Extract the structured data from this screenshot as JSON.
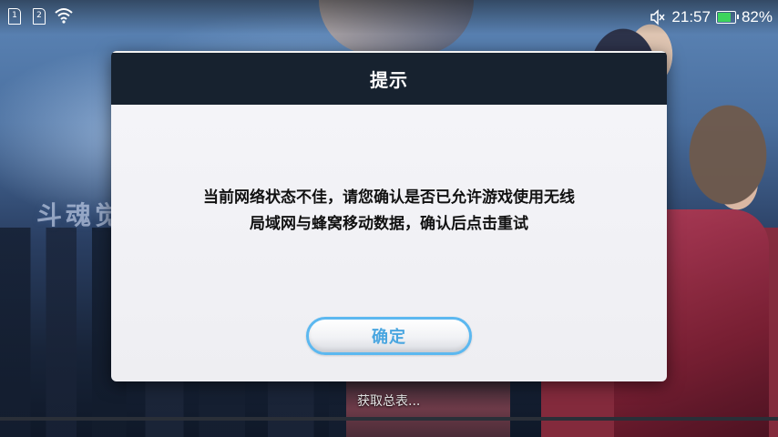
{
  "status_bar": {
    "sim1": "1",
    "sim2": "2",
    "time": "21:57",
    "battery_percent": "82%",
    "battery_level": 0.82,
    "icons": [
      "sim-card-icon",
      "sim-card-icon",
      "wifi-icon",
      "mute-icon",
      "battery-icon"
    ]
  },
  "background": {
    "game_title": "斗魂觉",
    "loading_text": "获取总表..."
  },
  "dialog": {
    "title": "提示",
    "message_lines": [
      "当前网络状态不佳，请您确认是否已允许游戏使用无线",
      "局域网与蜂窝移动数据，确认后点击重试"
    ],
    "confirm_label": "确定"
  },
  "colors": {
    "dialog_header": "#17222f",
    "dialog_body": "#f0f0f4",
    "button_accent": "#5cb8f0",
    "battery_green": "#3cd35c"
  }
}
